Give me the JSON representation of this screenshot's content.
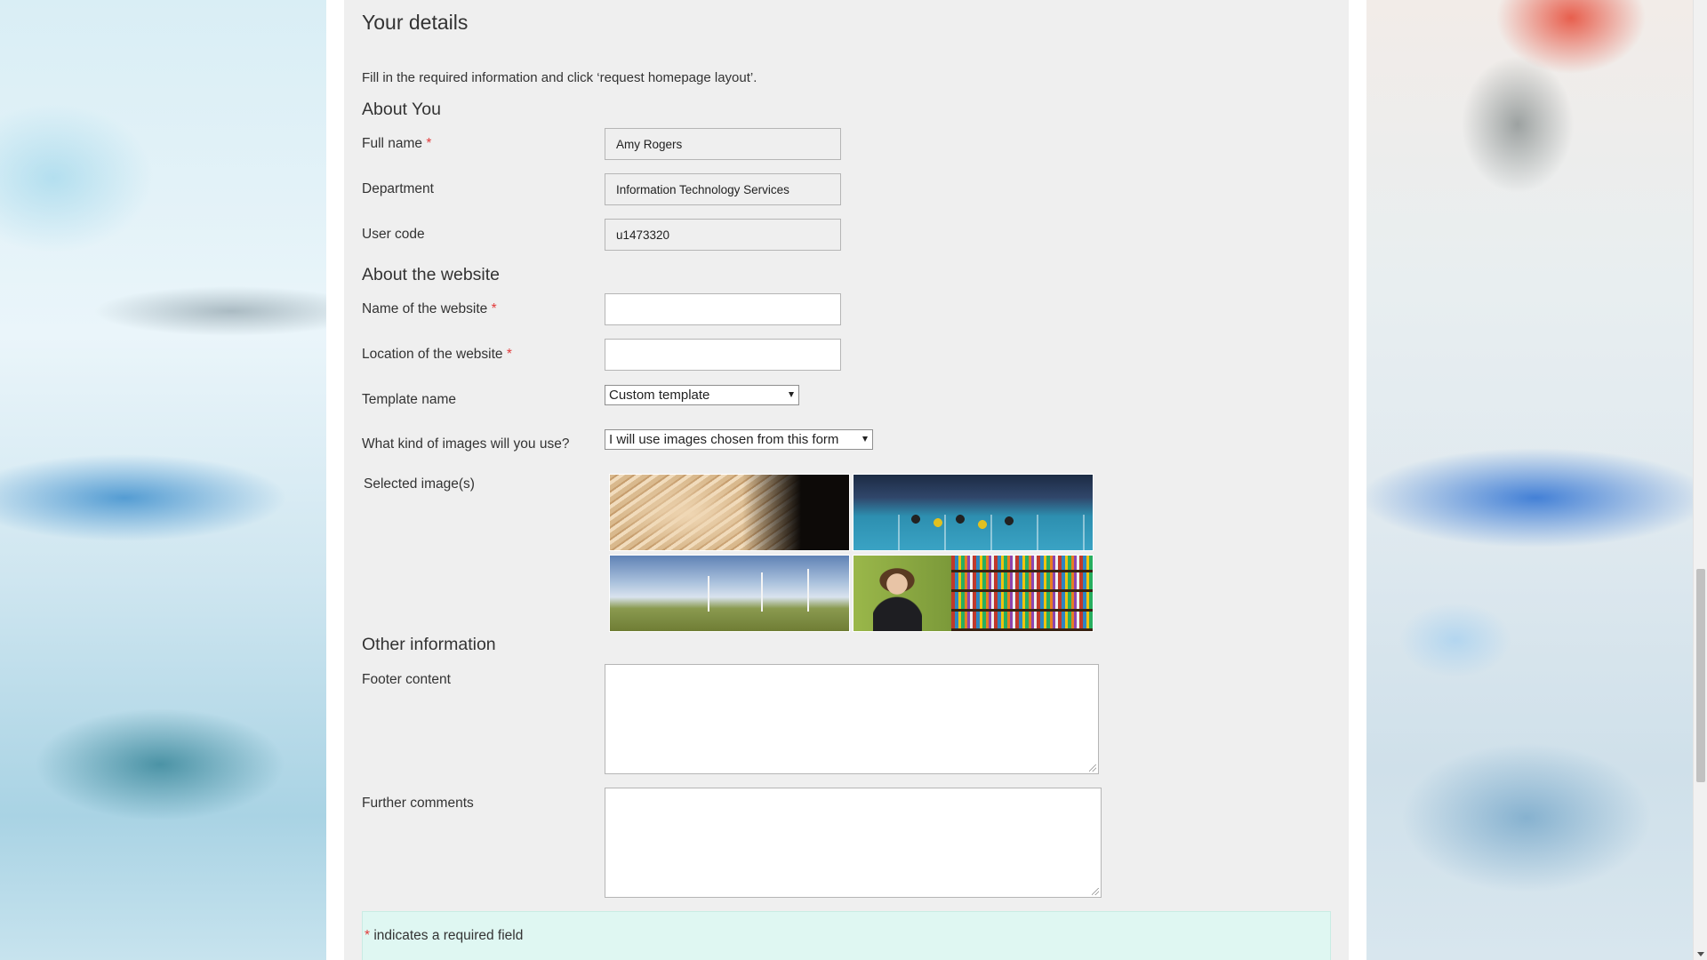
{
  "page": {
    "section_title": "Your details",
    "intro": "Fill in the required information and click ‘request homepage layout’."
  },
  "about_you": {
    "heading": "About You",
    "full_name": {
      "label": "Full name",
      "required_mark": "*",
      "value": "Amy Rogers"
    },
    "department": {
      "label": "Department",
      "value": "Information Technology Services"
    },
    "user_code": {
      "label": "User code",
      "value": "u1473320"
    }
  },
  "about_website": {
    "heading": "About the website",
    "name": {
      "label": "Name of the website",
      "required_mark": "*",
      "value": ""
    },
    "location": {
      "label": "Location of the website",
      "required_mark": "*",
      "value": ""
    },
    "template": {
      "label": "Template name",
      "selected": "Custom template"
    },
    "images_kind": {
      "label": "What kind of images will you use?",
      "selected": "I will use images chosen from this form"
    },
    "selected_images": {
      "label": "Selected image(s)",
      "images": [
        "open-book-image",
        "sports-hall-image",
        "wind-turbines-image",
        "student-library-image"
      ]
    }
  },
  "other_information": {
    "heading": "Other information",
    "footer": {
      "label": "Footer content",
      "value": ""
    },
    "comments": {
      "label": "Further comments",
      "value": ""
    }
  },
  "notice": {
    "required_mark": "*",
    "text": " indicates a required field"
  },
  "colors": {
    "required": "#e23b3b",
    "panel_bg": "#efefef",
    "notice_bg": "#dff7f2"
  }
}
